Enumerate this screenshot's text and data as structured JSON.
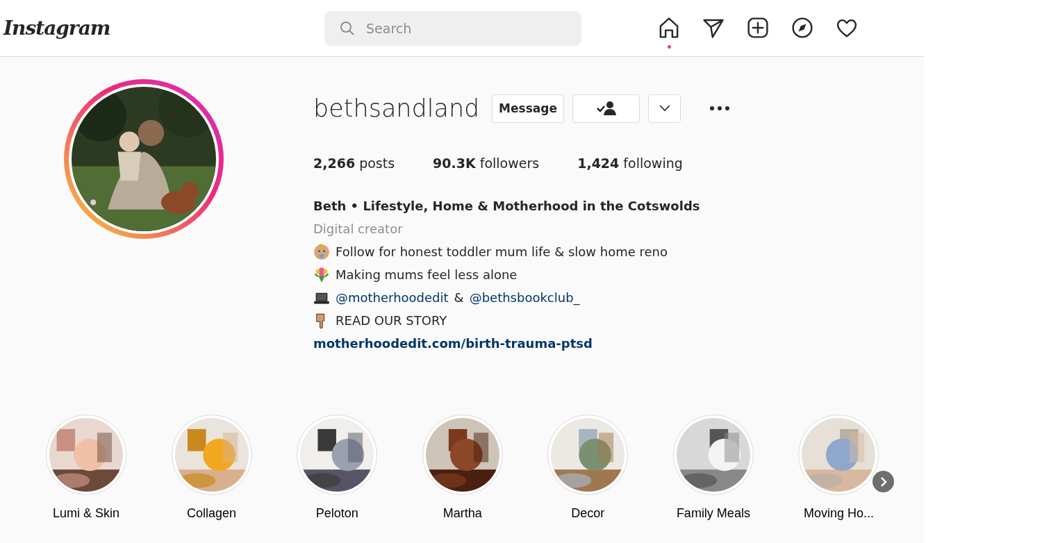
{
  "header": {
    "logo": "Instagram",
    "search": {
      "placeholder": "Search"
    },
    "nav": [
      {
        "kind": "home",
        "selected": true
      },
      {
        "kind": "send",
        "selected": false
      },
      {
        "kind": "add",
        "selected": false
      },
      {
        "kind": "explore",
        "selected": false
      },
      {
        "kind": "heart",
        "selected": false
      }
    ]
  },
  "profile": {
    "username": "bethsandland",
    "buttons": [
      {
        "kind": "text",
        "label": "Message"
      },
      {
        "kind": "follow"
      },
      {
        "kind": "dropdown"
      },
      {
        "kind": "more"
      }
    ],
    "stats": [
      {
        "value": "2,266",
        "label": "posts"
      },
      {
        "value": "90.3K",
        "label": "followers"
      },
      {
        "value": "1,424",
        "label": "following"
      }
    ],
    "name": "Beth • Lifestyle, Home & Motherhood in the Cotswolds",
    "category": "Digital creator",
    "bio": [
      {
        "kind": "baby",
        "text": "Follow for honest toddler mum life & slow home reno"
      },
      {
        "kind": "flowers",
        "text": "Making mums feel less alone"
      },
      {
        "kind": "laptop",
        "parts": [
          {
            "kind": "mention",
            "text": "@motherhoodedit"
          },
          {
            "kind": "plain",
            "text": "&"
          },
          {
            "kind": "mention",
            "text": "@bethsbookclub_"
          }
        ]
      },
      {
        "kind": "pointing",
        "text": "READ OUR STORY"
      }
    ],
    "link": "motherhoodedit.com/birth-trauma-ptsd"
  },
  "highlights": [
    {
      "label": "Lumi & Skin",
      "kind": "picture"
    },
    {
      "label": "Collagen",
      "kind": "picture"
    },
    {
      "label": "Peloton",
      "kind": "picture"
    },
    {
      "label": "Martha",
      "kind": "picture"
    },
    {
      "label": "Decor",
      "kind": "picture"
    },
    {
      "label": "Family Meals",
      "kind": "picture"
    },
    {
      "label": "Moving Ho...",
      "kind": "picture"
    }
  ]
}
